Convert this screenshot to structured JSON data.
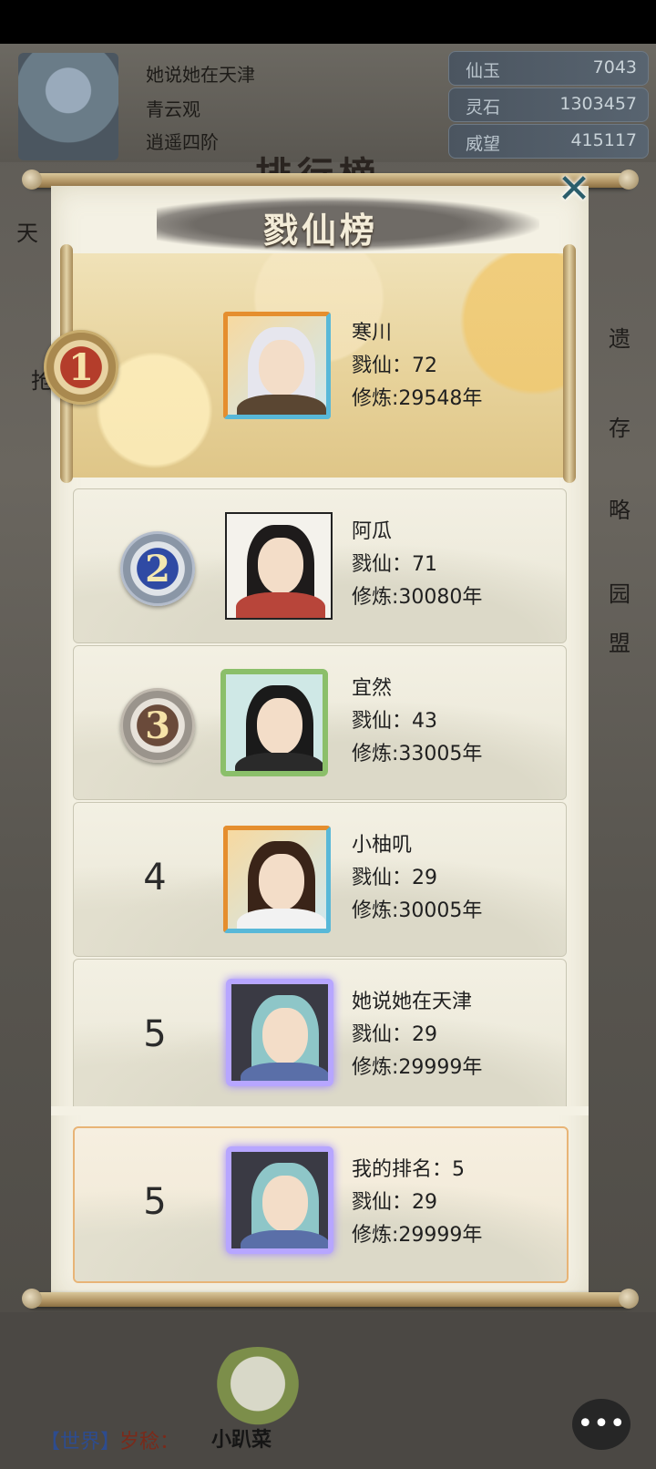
{
  "player": {
    "name": "她说她在天津",
    "sect": "青云观",
    "realm": "逍遥四阶"
  },
  "resources": [
    {
      "label": "仙玉",
      "value": "7043"
    },
    {
      "label": "灵石",
      "value": "1303457"
    },
    {
      "label": "威望",
      "value": "415117"
    }
  ],
  "background": {
    "title": "排行榜",
    "side_left": [
      "天",
      "抢"
    ],
    "side_right": [
      "遗",
      "存",
      "略",
      "园",
      "盟"
    ]
  },
  "panel": {
    "title": "戮仙榜",
    "close_glyph": "✕"
  },
  "ranking": [
    {
      "rank": "1",
      "name": "寒川",
      "kill_label": "戮仙：72",
      "cultivate_label": "修炼:29548年"
    },
    {
      "rank": "2",
      "name": "阿瓜",
      "kill_label": "戮仙：71",
      "cultivate_label": "修炼:30080年"
    },
    {
      "rank": "3",
      "name": "宜然",
      "kill_label": "戮仙：43",
      "cultivate_label": "修炼:33005年"
    },
    {
      "rank": "4",
      "name": "小柚叽",
      "kill_label": "戮仙：29",
      "cultivate_label": "修炼:30005年"
    },
    {
      "rank": "5",
      "name": "她说她在天津",
      "kill_label": "戮仙：29",
      "cultivate_label": "修炼:29999年"
    }
  ],
  "my_rank": {
    "rank": "5",
    "rank_label": "我的排名：5",
    "kill_label": "戮仙：29",
    "cultivate_label": "修炼:29999年"
  },
  "chat": {
    "channel": "【世界】",
    "user": "岁稔：",
    "text": "小趴菜"
  },
  "icons": {
    "chat": "chat-bubble-icon",
    "close": "close-icon"
  },
  "colors": {
    "panel_bg": "#f4f1e4",
    "first_card": "#e7d29a",
    "my_card_border": "#e8b476",
    "close_x": "#2b5d6b"
  }
}
